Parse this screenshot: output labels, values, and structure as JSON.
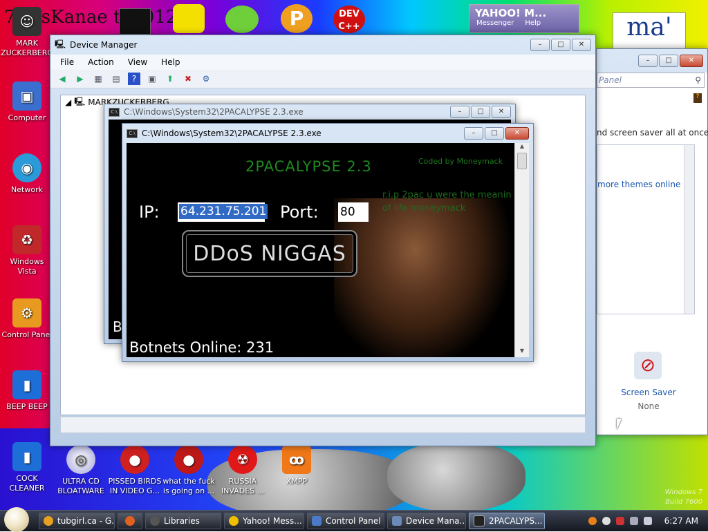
{
  "desktop_icons": [
    {
      "label": "MARK ZUCKERBERG",
      "icon": "user-icon"
    },
    {
      "label": "Computer",
      "icon": "computer-icon"
    },
    {
      "label": "Network",
      "icon": "network-icon"
    },
    {
      "label": "Windows Vista",
      "icon": "recycle-bin-icon"
    },
    {
      "label": "Control Panel",
      "icon": "control-panel-icon"
    },
    {
      "label": "BEEP BEEP",
      "icon": "blue-file-icon"
    },
    {
      "label": "COCK CLEANER",
      "icon": "blue-file-icon"
    },
    {
      "label": "ULTRA CD BLOATWARE",
      "icon": "cd-icon"
    },
    {
      "label": "PISSED BIRDS IN VIDEO G...",
      "icon": "angry-bird-icon"
    },
    {
      "label": "what the fuck is going on ...",
      "icon": "angry-bird-icon"
    },
    {
      "label": "RUSSIA INVADES ...",
      "icon": "radiation-icon"
    },
    {
      "label": "XMPP",
      "icon": "xampp-icon"
    }
  ],
  "top_banner": {
    "text": "7 ossKanae tio 012"
  },
  "yahoo": {
    "title": "YAHOO! M...",
    "sub": "Messenger",
    "help": "Help"
  },
  "control_panel": {
    "search_placeholder": "Panel",
    "text1": "nd screen saver all at once.",
    "link": "more themes online",
    "screen_saver_label": "Screen Saver",
    "screen_saver_value": "None"
  },
  "device_manager": {
    "title": "Device Manager",
    "menu": [
      "File",
      "Action",
      "View",
      "Help"
    ],
    "root": "MARKZUCKERBERG"
  },
  "console_back": {
    "title": "C:\\Windows\\System32\\2PACALYPSE 2.3.exe",
    "fragment": "B"
  },
  "console": {
    "title": "C:\\Windows\\System32\\2PACALYPSE 2.3.exe",
    "app_title": "2PACALYPSE  2.3",
    "coded_by": "Coded by Moneymack",
    "rip": "r.i.p 2pac u were the meanin",
    "rip2": "of life moneymack",
    "ip_label": "IP:",
    "ip_value": "64.231.75.201",
    "port_label": "Port:",
    "port_value": "80",
    "button": "DDoS NIGGAS",
    "botnets": "Botnets Online: 231"
  },
  "taskbar": {
    "tasks": [
      {
        "label": "tubgirl.ca - G...",
        "color": "#e8a020"
      },
      {
        "label": "",
        "color": "#e06020"
      },
      {
        "label": "Libraries",
        "color": "#555555"
      },
      {
        "label": "Yahoo! Mess...",
        "color": "#f0c000"
      },
      {
        "label": "Control Panel",
        "color": "#4a7ac8"
      },
      {
        "label": "Device Mana...",
        "color": "#6a8ab8"
      },
      {
        "label": "2PACALYPS...",
        "color": "#222222"
      }
    ],
    "clock": "6:27 AM"
  },
  "watermark": {
    "line1": "Windows 7",
    "line2": "Build 7600"
  },
  "colors": {
    "console_green": "#1e8a1e",
    "ip_select": "#316ac5",
    "titlebar": "#c4d6ee"
  }
}
